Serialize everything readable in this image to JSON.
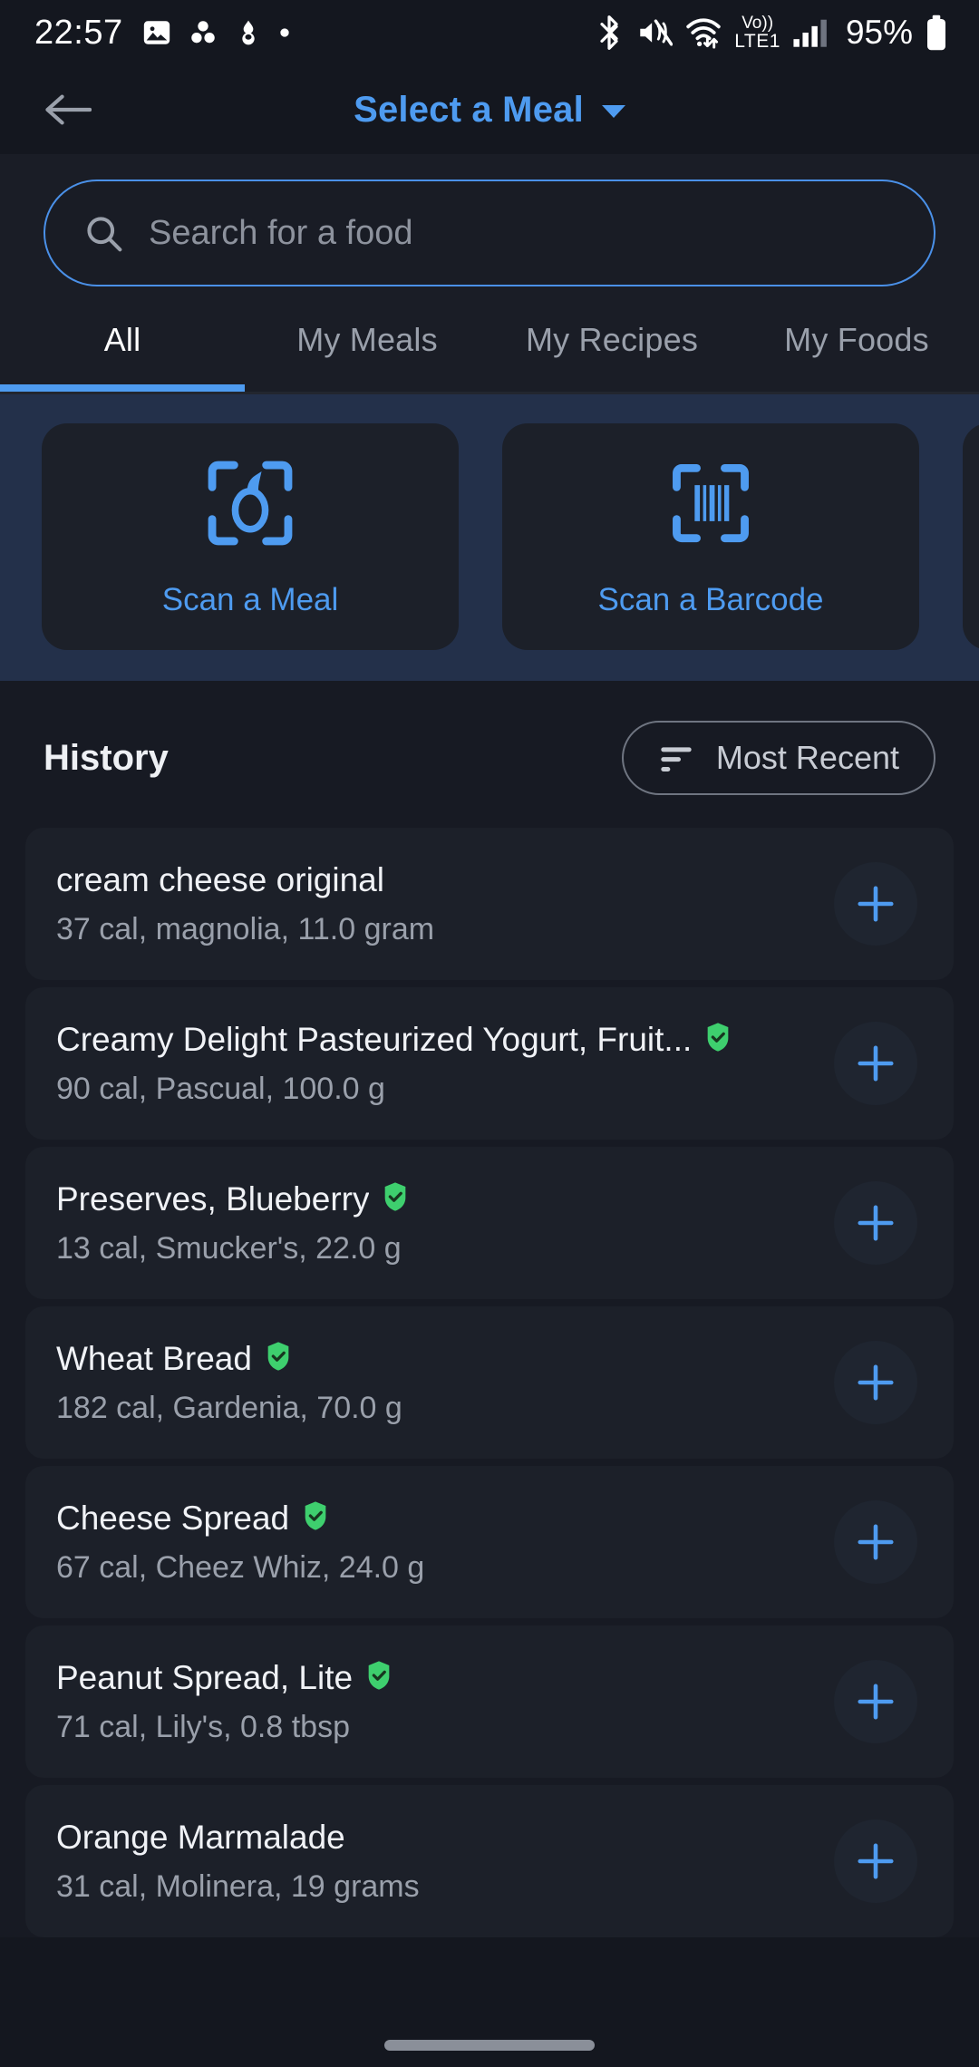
{
  "status_bar": {
    "time": "22:57",
    "battery_percent": "95%",
    "left_icons": [
      "image-icon",
      "three-dots-cluster-icon",
      "snowman-icon",
      "dot-icon"
    ],
    "right_icons": [
      "bluetooth-icon",
      "vibrate-mute-icon",
      "wifi-icon",
      "volte-icon",
      "signal-bars-icon",
      "battery-icon"
    ],
    "network_label": "Vo))",
    "network_label2": "LTE1"
  },
  "appbar": {
    "back_icon": "arrow-left-icon",
    "title": "Select a Meal",
    "dropdown_icon": "caret-down-icon"
  },
  "search": {
    "placeholder": "Search for a food",
    "value": "",
    "icon": "search-icon"
  },
  "tabs": {
    "items": [
      {
        "label": "All",
        "active": true
      },
      {
        "label": "My Meals",
        "active": false
      },
      {
        "label": "My Recipes",
        "active": false
      },
      {
        "label": "My Foods",
        "active": false
      }
    ]
  },
  "scan_banner": {
    "cards": [
      {
        "label": "Scan a Meal",
        "icon": "scan-meal-icon"
      },
      {
        "label": "Scan a Barcode",
        "icon": "scan-barcode-icon"
      }
    ]
  },
  "history": {
    "title": "History",
    "sort": {
      "label": "Most Recent",
      "icon": "sort-icon"
    },
    "items": [
      {
        "name": "cream cheese original",
        "details": "37 cal, magnolia, 11.0 gram",
        "verified": false
      },
      {
        "name": "Creamy Delight Pasteurized Yogurt, Fruit...",
        "details": "90 cal, Pascual, 100.0 g",
        "verified": true
      },
      {
        "name": "Preserves, Blueberry",
        "details": "13 cal, Smucker's, 22.0 g",
        "verified": true
      },
      {
        "name": "Wheat Bread",
        "details": "182 cal, Gardenia, 70.0 g",
        "verified": true
      },
      {
        "name": "Cheese Spread",
        "details": "67 cal, Cheez Whiz, 24.0 g",
        "verified": true
      },
      {
        "name": "Peanut Spread, Lite",
        "details": "71 cal, Lily's, 0.8 tbsp",
        "verified": true
      },
      {
        "name": "Orange Marmalade",
        "details": "31 cal, Molinera, 19 grams",
        "verified": false
      }
    ],
    "add_icon": "plus-icon"
  },
  "colors": {
    "accent_blue": "#4e9bf0",
    "verified_green": "#3ecf6e",
    "page_bg": "#171a23",
    "banner_bg": "#23304a",
    "card_bg": "#1c2029"
  }
}
